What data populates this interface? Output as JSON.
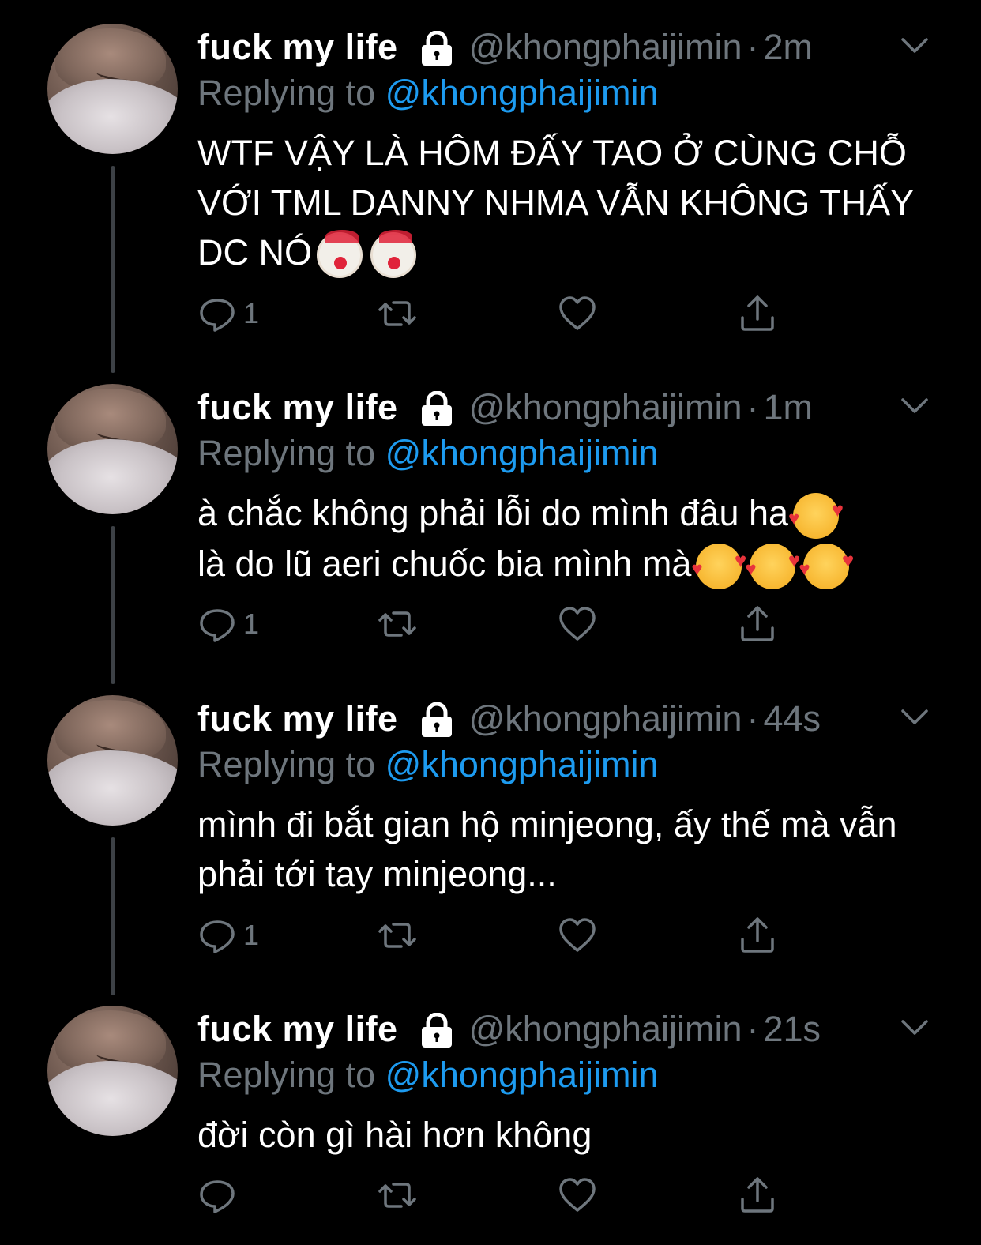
{
  "colors": {
    "background": "#000000",
    "text": "#ffffff",
    "secondary": "#6e767d",
    "mention": "#1d9bf0",
    "thread_line": "#3d4146"
  },
  "tweets": [
    {
      "name": "fuck my life",
      "handle": "@khongphaijimin",
      "dot": "·",
      "time": "2m",
      "replying_prefix": "Replying to ",
      "replying_to": "@khongphaijimin",
      "text": "WTF VẬY LÀ HÔM ĐẤY TAO Ở CÙNG CHỖ VỚI TML DANNY NHMA VẪN KHÔNG THẤY DC NÓ",
      "emojis": [
        "clown-face",
        "clown-face"
      ],
      "reply_count": "1"
    },
    {
      "name": "fuck my life",
      "handle": "@khongphaijimin",
      "dot": "·",
      "time": "1m",
      "replying_prefix": "Replying to ",
      "replying_to": "@khongphaijimin",
      "text_line1": "à chắc không phải lỗi do mình đâu ha",
      "text_line2": "là do lũ aeri chuốc bia mình mà",
      "emojis_line1": [
        "smiling-face-with-hearts"
      ],
      "emojis_line2": [
        "smiling-face-with-hearts",
        "smiling-face-with-hearts",
        "smiling-face-with-hearts"
      ],
      "reply_count": "1"
    },
    {
      "name": "fuck my life",
      "handle": "@khongphaijimin",
      "dot": "·",
      "time": "44s",
      "replying_prefix": "Replying to ",
      "replying_to": "@khongphaijimin",
      "text": "mình đi bắt gian hộ minjeong, ấy thế mà vẫn phải tới tay minjeong...",
      "reply_count": "1"
    },
    {
      "name": "fuck my life",
      "handle": "@khongphaijimin",
      "dot": "·",
      "time": "21s",
      "replying_prefix": "Replying to ",
      "replying_to": "@khongphaijimin",
      "text": "đời còn gì hài hơn không",
      "reply_count": ""
    }
  ],
  "icons": {
    "reply": "reply-icon",
    "retweet": "retweet-icon",
    "like": "heart-icon",
    "share": "share-icon",
    "lock": "lock-icon",
    "more": "chevron-down-icon"
  }
}
